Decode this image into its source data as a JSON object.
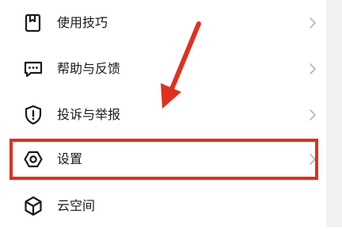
{
  "menu": {
    "items": [
      {
        "label": "使用技巧",
        "icon": "bookmark-page-icon"
      },
      {
        "label": "帮助与反馈",
        "icon": "chat-bubble-icon"
      },
      {
        "label": "投诉与举报",
        "icon": "shield-alert-icon"
      },
      {
        "label": "设置",
        "icon": "settings-hexagon-icon"
      },
      {
        "label": "云空间",
        "icon": "cloud-cube-icon"
      }
    ]
  },
  "annotation": {
    "highlight_color": "#e0301e",
    "highlighted_item": "设置"
  },
  "colors": {
    "icon_stroke": "#1a1a1a",
    "chevron": "#b4b4b4",
    "background": "#ffffff"
  }
}
